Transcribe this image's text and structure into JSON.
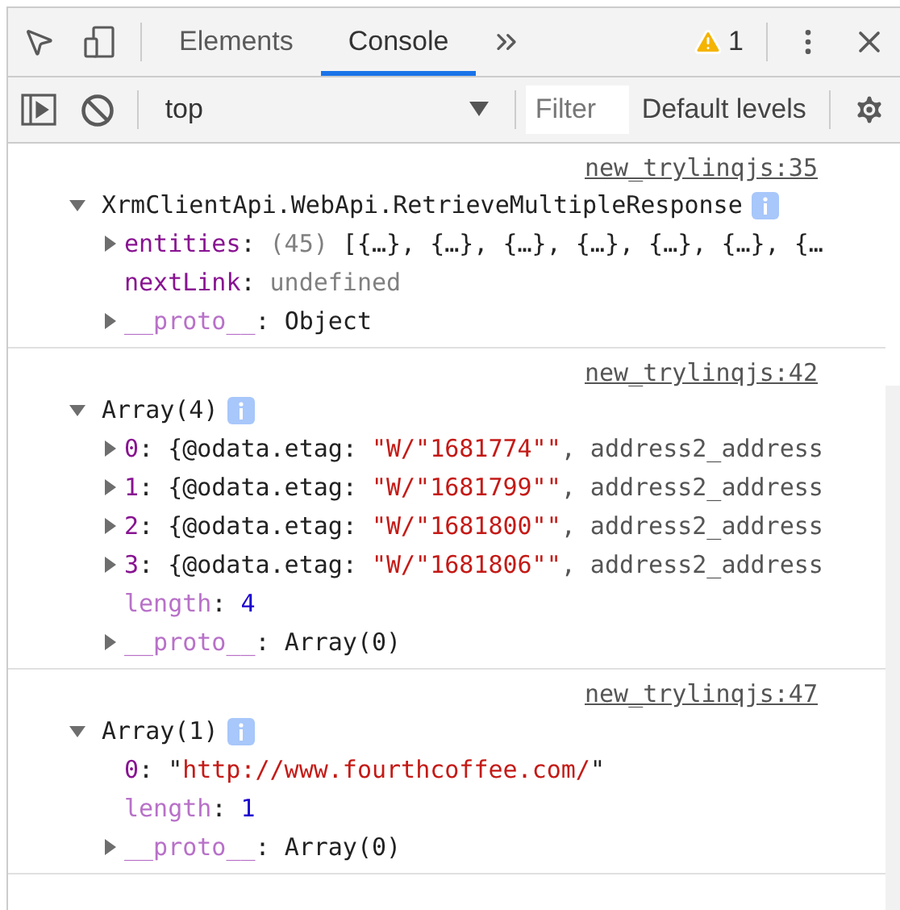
{
  "tabs": [
    {
      "label": "Elements",
      "selected": false
    },
    {
      "label": "Console",
      "selected": true
    }
  ],
  "warnings": {
    "count": "1"
  },
  "toolbar": {
    "context": "top",
    "filter": {
      "placeholder": "Filter"
    },
    "levels": "Default levels"
  },
  "messages": [
    {
      "source": "new_trylinqjs:35",
      "expanded": true,
      "header": "XrmClientApi.WebApi.RetrieveMultipleResponse",
      "properties": [
        {
          "key": "entities",
          "sep": ":",
          "dim": false,
          "expandable": true,
          "value": [
            {
              "kind": "meta",
              "text": "(45)"
            },
            {
              "kind": "plain",
              "text": "[{…}, {…}, {…}, {…}, {…}, {…}, {…"
            }
          ]
        },
        {
          "key": "nextLink",
          "sep": ":",
          "dim": false,
          "expandable": false,
          "value": [
            {
              "kind": "meta",
              "text": "undefined"
            }
          ]
        },
        {
          "key": "__proto__",
          "sep": ":",
          "dim": true,
          "expandable": true,
          "value": [
            {
              "kind": "plain",
              "text": "Object"
            }
          ]
        }
      ]
    },
    {
      "source": "new_trylinqjs:42",
      "expanded": true,
      "header": "Array(4)",
      "properties": [
        {
          "key": "0",
          "sep": ":",
          "dim": false,
          "expandable": true,
          "value": [
            {
              "kind": "plain",
              "text": "{@odata.etag:"
            },
            {
              "kind": "string",
              "text": "\"W/\"1681774\"\""
            },
            {
              "kind": "summary",
              "text": ", address2_address"
            }
          ]
        },
        {
          "key": "1",
          "sep": ":",
          "dim": false,
          "expandable": true,
          "value": [
            {
              "kind": "plain",
              "text": "{@odata.etag:"
            },
            {
              "kind": "string",
              "text": "\"W/\"1681799\"\""
            },
            {
              "kind": "summary",
              "text": ", address2_address"
            }
          ]
        },
        {
          "key": "2",
          "sep": ":",
          "dim": false,
          "expandable": true,
          "value": [
            {
              "kind": "plain",
              "text": "{@odata.etag:"
            },
            {
              "kind": "string",
              "text": "\"W/\"1681800\"\""
            },
            {
              "kind": "summary",
              "text": ", address2_address"
            }
          ]
        },
        {
          "key": "3",
          "sep": ":",
          "dim": false,
          "expandable": true,
          "value": [
            {
              "kind": "plain",
              "text": "{@odata.etag:"
            },
            {
              "kind": "string",
              "text": "\"W/\"1681806\"\""
            },
            {
              "kind": "summary",
              "text": ", address2_address"
            }
          ]
        },
        {
          "key": "length",
          "sep": ":",
          "dim": true,
          "expandable": false,
          "value": [
            {
              "kind": "number",
              "text": "4"
            }
          ]
        },
        {
          "key": "__proto__",
          "sep": ":",
          "dim": true,
          "expandable": true,
          "value": [
            {
              "kind": "plain",
              "text": "Array(0)"
            }
          ]
        }
      ]
    },
    {
      "source": "new_trylinqjs:47",
      "expanded": true,
      "header": "Array(1)",
      "properties": [
        {
          "key": "0",
          "sep": ":",
          "dim": false,
          "expandable": false,
          "value": [
            {
              "kind": "plain",
              "text": "\""
            },
            {
              "kind": "string",
              "text": "http://www.fourthcoffee.com/"
            },
            {
              "kind": "plain",
              "text": "\""
            }
          ]
        },
        {
          "key": "length",
          "sep": ":",
          "dim": true,
          "expandable": false,
          "value": [
            {
              "kind": "number",
              "text": "1"
            }
          ]
        },
        {
          "key": "__proto__",
          "sep": ":",
          "dim": true,
          "expandable": true,
          "value": [
            {
              "kind": "plain",
              "text": "Array(0)"
            }
          ]
        }
      ]
    }
  ]
}
